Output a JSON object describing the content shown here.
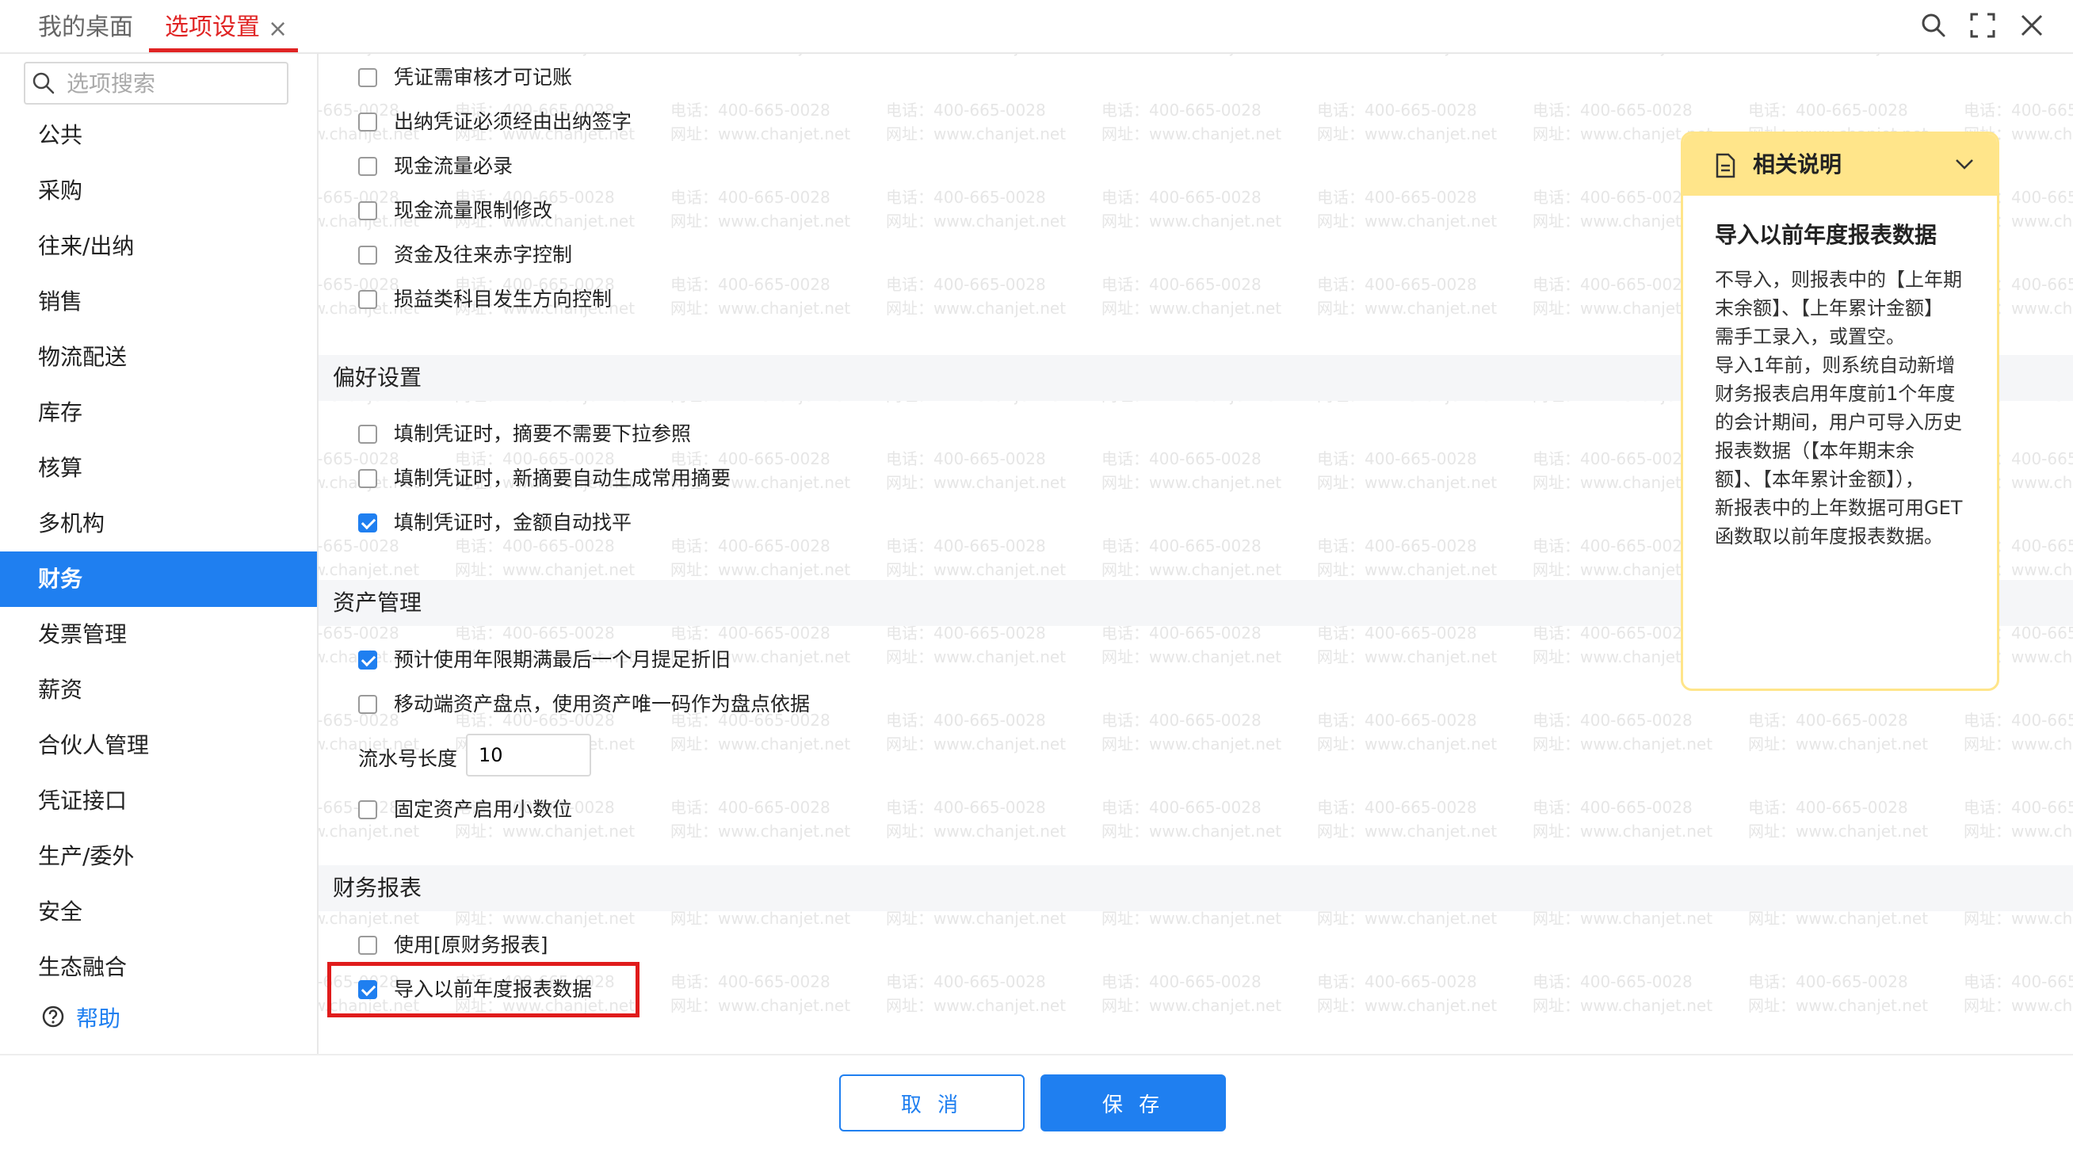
{
  "tabs": {
    "home": "我的桌面",
    "active": "选项设置",
    "close": "×"
  },
  "search": {
    "placeholder": "选项搜索"
  },
  "sidebar": {
    "items": [
      "公共",
      "采购",
      "往来/出纳",
      "销售",
      "物流配送",
      "库存",
      "核算",
      "多机构",
      "财务",
      "发票管理",
      "薪资",
      "合伙人管理",
      "凭证接口",
      "生产/委外",
      "安全",
      "生态融合"
    ],
    "active_index": 8,
    "help": "帮助"
  },
  "voucher_options": [
    {
      "label": "凭证需审核才可记账",
      "checked": false
    },
    {
      "label": "出纳凭证必须经由出纳签字",
      "checked": false
    },
    {
      "label": "现金流量必录",
      "checked": false
    },
    {
      "label": "现金流量限制修改",
      "checked": false
    },
    {
      "label": "资金及往来赤字控制",
      "checked": false
    },
    {
      "label": "损益类科目发生方向控制",
      "checked": false
    }
  ],
  "preferences": {
    "title": "偏好设置",
    "options": [
      {
        "label": "填制凭证时，摘要不需要下拉参照",
        "checked": false
      },
      {
        "label": "填制凭证时，新摘要自动生成常用摘要",
        "checked": false
      },
      {
        "label": "填制凭证时，金额自动找平",
        "checked": true
      }
    ]
  },
  "assets": {
    "title": "资产管理",
    "options": [
      {
        "label": "预计使用年限期满最后一个月提足折旧",
        "checked": true
      },
      {
        "label": "移动端资产盘点，使用资产唯一码作为盘点依据",
        "checked": false
      }
    ],
    "serial_length_label": "流水号长度",
    "serial_length_value": "10",
    "decimal_option": {
      "label": "固定资产启用小数位",
      "checked": false
    }
  },
  "reports": {
    "title": "财务报表",
    "options": [
      {
        "label": "使用[原财务报表]",
        "checked": false
      },
      {
        "label": "导入以前年度报表数据",
        "checked": true
      }
    ]
  },
  "info_panel": {
    "title": "相关说明",
    "subtitle": "导入以前年度报表数据",
    "lines": [
      "不导入，则报表中的【上年期",
      "末余额】、【上年累计金额】",
      "需手工录入，或置空。",
      "导入1年前，则系统自动新增",
      "财务报表启用年度前1个年度",
      "的会计期间，用户可导入历史",
      "报表数据（【本年期末余",
      "额】、【本年累计金额】），",
      "新报表中的上年数据可用GET",
      "函数取以前年度报表数据。"
    ]
  },
  "footer": {
    "cancel": "取 消",
    "save": "保 存"
  },
  "watermark": {
    "phone": "电话：400-665-0028",
    "site": "网址：www.chanjet.net"
  },
  "colors": {
    "accent": "#1f7ff0",
    "active_tab": "#e02424",
    "highlight": "#e01b1b",
    "info_header": "#ffe58a"
  }
}
